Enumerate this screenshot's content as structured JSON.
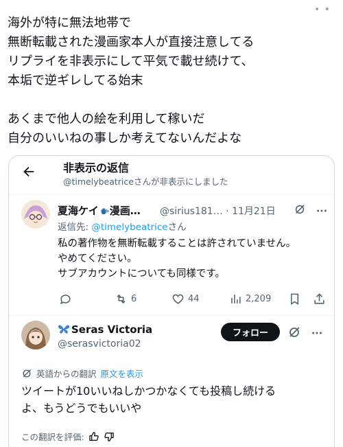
{
  "top_dots": "• •",
  "main_text": {
    "lines": [
      "海外が特に無法地帯で",
      "無断転載された漫画家本人が直接注意してる",
      "リプライを非表示にして平気で載せ続けて、",
      "本垢で逆ギレしてる始末",
      "あくまで他人の絵を利用して稼いだ",
      "自分のいいねの事しか考えてないんだよな"
    ]
  },
  "card": {
    "header": {
      "title": "非表示の返信",
      "subtitle": "@timelybeatriceさんが非表示にしました"
    },
    "tweet1": {
      "display_name_a": "夏海ケイ",
      "display_name_b": "漫画…",
      "handle_date": "@sirius181… · 11月21日",
      "reply_prefix": "返信先: ",
      "reply_mention": "@timelybeatrice",
      "reply_suffix": "さん",
      "body_lines": [
        "私の著作物を無断転載することは許されていません。",
        "やめてください。",
        "サブアカウントについても同様です。"
      ],
      "actions": {
        "reply_count": "",
        "retweet_count": "6",
        "like_count": "44",
        "views_count": "2,209"
      }
    },
    "tweet2": {
      "display_name": "Seras Victoria",
      "handle": "@serasvictoria02",
      "follow_label": "フォロー",
      "translated_from": "英語からの翻訳",
      "show_original": "原文を表示",
      "body_lines": [
        "ツイートが10いいねしかつかなくても投稿し続ける",
        "よ、もうどうでもいいや"
      ],
      "rate_label": "この翻訳を評価:"
    }
  },
  "colors": {
    "accent": "#1d9bf0",
    "text": "#0f1419",
    "muted": "#536471",
    "border": "#cfd9de",
    "follow_bg": "#0f1419",
    "butterfly": "#3b82d6"
  }
}
